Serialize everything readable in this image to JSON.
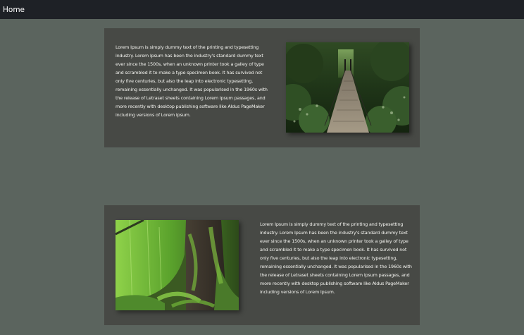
{
  "nav": {
    "home_label": "Home"
  },
  "cards": [
    {
      "text": "Lorem Ipsum is simply dummy text of the printing and typesetting industry. Lorem Ipsum has been the industry's standard dummy text ever since the 1500s, when an unknown printer took a galley of type and scrambled it to make a type specimen book. It has survived not only five centuries, but also the leap into electronic typesetting, remaining essentially unchanged. It was popularised in the 1960s with the release of Letraset sheets containing Lorem Ipsum passages, and more recently with desktop publishing software like Aldus PageMaker including versions of Lorem Ipsum.",
      "image": "forest-suspension-bridge-photo"
    },
    {
      "text": "Lorem Ipsum is simply dummy text of the printing and typesetting industry. Lorem Ipsum has been the industry's standard dummy text ever since the 1500s, when an unknown printer took a galley of type and scrambled it to make a type specimen book. It has survived not only five centuries, but also the leap into electronic typesetting, remaining essentially unchanged. It was popularised in the 1960s with the release of Letraset sheets containing Lorem Ipsum passages, and more recently with desktop publishing software like Aldus PageMaker including versions of Lorem Ipsum.",
      "image": "mossy-tree-roots-photo"
    }
  ],
  "colors": {
    "page_background": "#5b645e",
    "navbar_background": "#1e2126",
    "card_background": "#474945",
    "text": "#ffffff"
  }
}
